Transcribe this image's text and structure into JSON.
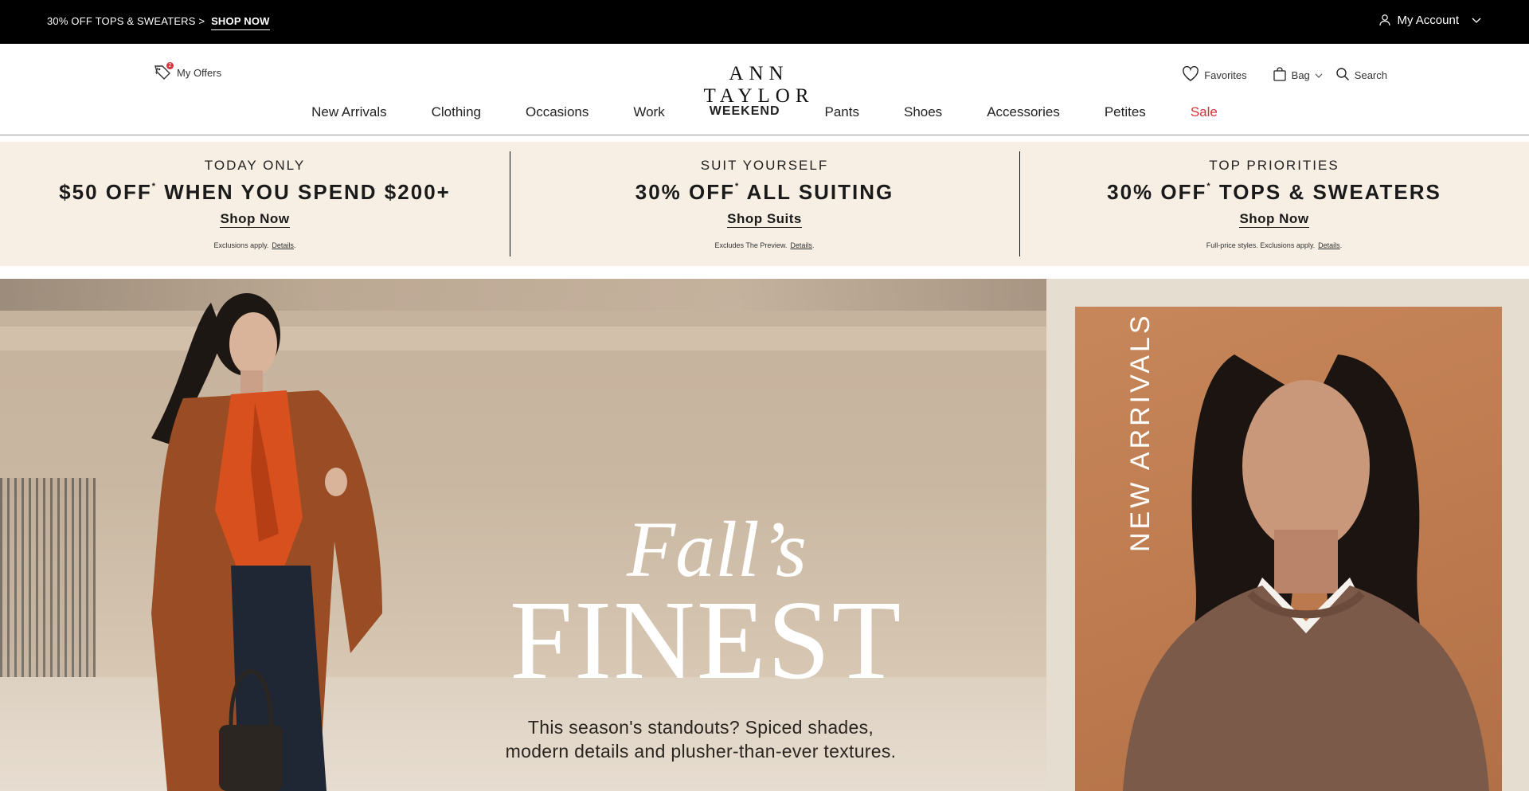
{
  "topbar": {
    "promo_text": "30% OFF TOPS & SWEATERS >",
    "promo_link": "SHOP NOW",
    "account_label": "My Account"
  },
  "header": {
    "offers_label": "My Offers",
    "offers_badge": "2",
    "logo": "ANN TAYLOR",
    "favorites_label": "Favorites",
    "bag_label": "Bag",
    "search_label": "Search"
  },
  "nav": [
    {
      "label": "New Arrivals"
    },
    {
      "label": "Clothing"
    },
    {
      "label": "Occasions"
    },
    {
      "label": "Work"
    },
    {
      "label": "WEEKEND"
    },
    {
      "label": "Pants"
    },
    {
      "label": "Shoes"
    },
    {
      "label": "Accessories"
    },
    {
      "label": "Petites"
    },
    {
      "label": "Sale"
    }
  ],
  "promos": [
    {
      "eyebrow": "TODAY ONLY",
      "headline": "$50 OFF",
      "headline_rest": " WHEN YOU SPEND $200+",
      "cta": "Shop Now",
      "fine": "Exclusions apply.",
      "details": "Details"
    },
    {
      "eyebrow": "SUIT YOURSELF",
      "headline": "30% OFF",
      "headline_rest": " ALL SUITING",
      "cta": "Shop Suits",
      "fine": "Excludes The Preview.",
      "details": "Details"
    },
    {
      "eyebrow": "TOP PRIORITIES",
      "headline": "30% OFF",
      "headline_rest": " TOPS & SWEATERS",
      "cta": "Shop Now",
      "fine": "Full-price styles. Exclusions apply.",
      "details": "Details"
    }
  ],
  "hero": {
    "script_title": "Fall’s",
    "big_title": "FINEST",
    "subtitle_line1": "This season's standouts? Spiced shades,",
    "subtitle_line2": "modern details and plusher-than-ever textures.",
    "side_label": "NEW ARRIVALS"
  },
  "colors": {
    "sale": "#d8303a",
    "promo_bg": "#f7efe4",
    "topbar_bg": "#000000"
  }
}
